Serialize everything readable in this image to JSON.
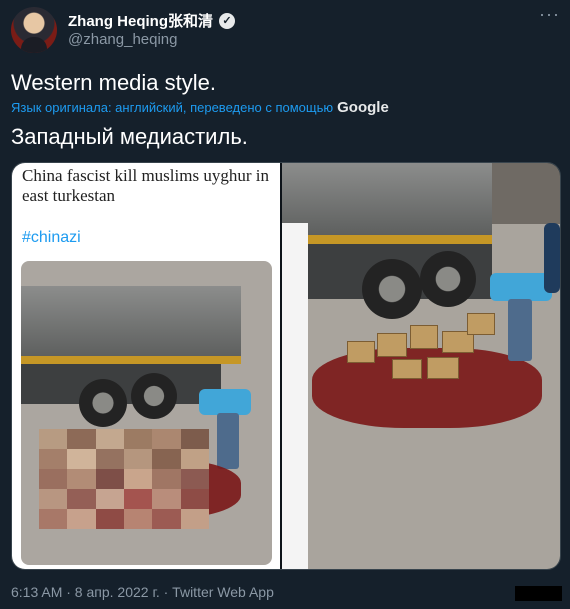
{
  "author": {
    "display_name": "Zhang Heqing张和清",
    "handle": "@zhang_heqing",
    "verified_icon": "verified-badge-icon",
    "avatar_icon": "profile-avatar"
  },
  "more_icon": "more-options-icon",
  "tweet": {
    "text": "Western media style.",
    "translate_label": "Язык оригинала: английский, переведено с помощью",
    "translate_brand": "Google",
    "translated_text": "Западный медиастиль."
  },
  "media": {
    "caption": "China fascist kill muslims uyghur in east turkestan",
    "hashtag": "#chinazi"
  },
  "meta": {
    "timestamp": "6:13 AM · 8 апр. 2022 г. · Twitter Web App"
  },
  "colors": {
    "background": "#15202b",
    "link": "#1d9bf0",
    "muted": "#8b98a5"
  }
}
